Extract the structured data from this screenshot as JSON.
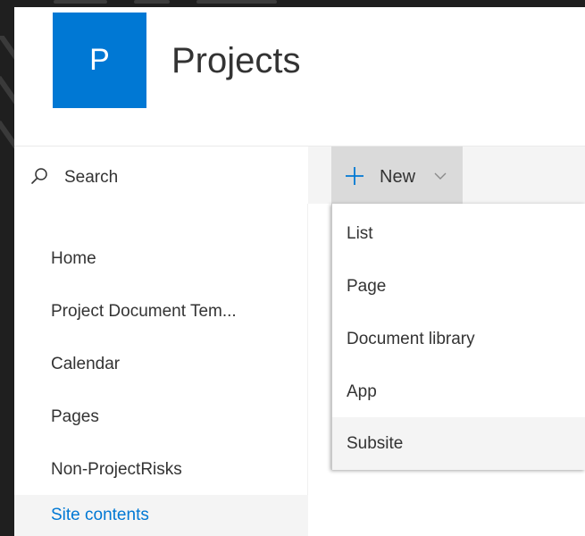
{
  "site": {
    "logo_letter": "P",
    "title": "Projects",
    "brand_color": "#0078d4"
  },
  "search": {
    "label": "Search",
    "icon": "search-icon"
  },
  "command_bar": {
    "new_label": "New",
    "new_icon": "plus-icon",
    "dropdown_icon": "chevron-down-icon"
  },
  "nav": {
    "items": [
      {
        "label": "Home"
      },
      {
        "label": "Project Document Tem..."
      },
      {
        "label": "Calendar"
      },
      {
        "label": "Pages"
      },
      {
        "label": "Non-ProjectRisks"
      },
      {
        "label": "Site contents",
        "selected": true
      }
    ]
  },
  "new_menu": {
    "items": [
      {
        "label": "List"
      },
      {
        "label": "Page"
      },
      {
        "label": "Document library"
      },
      {
        "label": "App"
      },
      {
        "label": "Subsite",
        "hovered": true
      }
    ]
  },
  "colors": {
    "accent": "#0078d4",
    "selected_background": "#f4f4f4",
    "button_pressed_background": "#dadada"
  }
}
